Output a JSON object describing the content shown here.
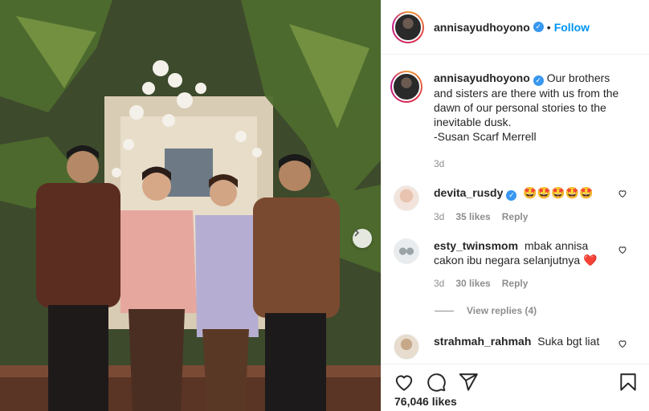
{
  "post": {
    "username": "annisayudhoyono",
    "follow_label": "Follow",
    "dot": "•",
    "caption_lines": [
      "Our brothers",
      "and sisters are there with us from the",
      "dawn of our personal stories to the",
      "inevitable dusk.",
      "-Susan Scarf Merrell"
    ],
    "caption_age": "3d",
    "likes": "76,046 likes"
  },
  "comments": [
    {
      "username": "devita_rusdy",
      "verified": true,
      "text": "🤩🤩🤩🤩🤩",
      "age": "3d",
      "likes": "35 likes",
      "reply_label": "Reply"
    },
    {
      "username": "esty_twinsmom",
      "verified": false,
      "text": "mbak annisa cakon ibu negara selanjutnya ❤️",
      "age": "3d",
      "likes": "30 likes",
      "reply_label": "Reply",
      "view_replies": "View replies (4)"
    },
    {
      "username": "strahmah_rahmah",
      "verified": false,
      "text": "Suka bgt liat"
    }
  ],
  "icons": {
    "like": "heart-icon",
    "comment": "comment-icon",
    "share": "share-icon",
    "save": "bookmark-icon",
    "next": "chevron-right-icon",
    "verified": "verified-badge-icon"
  },
  "colors": {
    "accent": "#0095f6",
    "verified": "#3897f0",
    "muted": "#8e8e8e",
    "heart_red": "#ed4956"
  }
}
